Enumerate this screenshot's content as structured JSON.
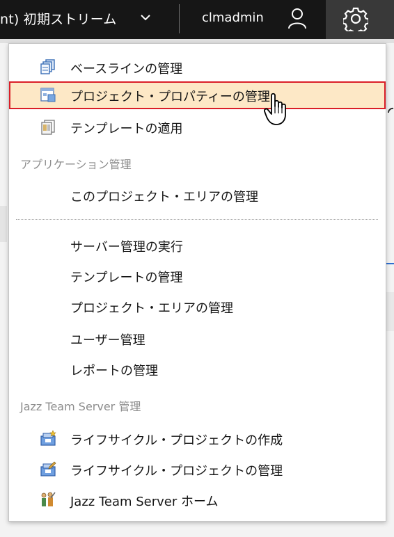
{
  "header": {
    "project_title": "nt) 初期ストリーム",
    "user_name": "clmadmin"
  },
  "menu": {
    "items_top": [
      {
        "label": "ベースラインの管理",
        "icon": "baseline-icon"
      },
      {
        "label": "プロジェクト・プロパティーの管理",
        "icon": "project-properties-icon",
        "highlighted": true
      },
      {
        "label": "テンプレートの適用",
        "icon": "template-icon"
      }
    ],
    "app_admin_label": "アプリケーション管理",
    "app_items": [
      {
        "label": "このプロジェクト・エリアの管理"
      },
      {
        "label": "サーバー管理の実行"
      },
      {
        "label": "テンプレートの管理"
      },
      {
        "label": "プロジェクト・エリアの管理"
      },
      {
        "label": "ユーザー管理"
      },
      {
        "label": "レポートの管理"
      }
    ],
    "jts_admin_label": "Jazz Team Server 管理",
    "jts_items": [
      {
        "label": "ライフサイクル・プロジェクトの作成",
        "icon": "lifecycle-create-icon"
      },
      {
        "label": "ライフサイクル・プロジェクトの管理",
        "icon": "lifecycle-manage-icon"
      },
      {
        "label": "Jazz Team Server ホーム",
        "icon": "jts-home-icon"
      }
    ]
  }
}
